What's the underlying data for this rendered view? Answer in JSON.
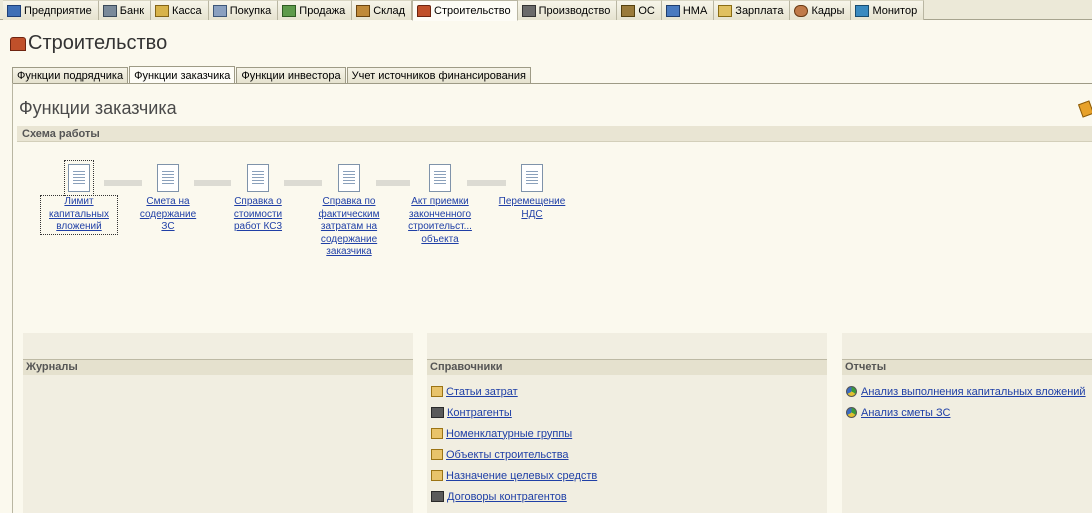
{
  "top_tabs": [
    {
      "label": "Предприятие",
      "icon": "enterprise-icon"
    },
    {
      "label": "Банк",
      "icon": "bank-icon"
    },
    {
      "label": "Касса",
      "icon": "cash-icon"
    },
    {
      "label": "Покупка",
      "icon": "purchase-icon"
    },
    {
      "label": "Продажа",
      "icon": "sale-icon"
    },
    {
      "label": "Склад",
      "icon": "warehouse-icon"
    },
    {
      "label": "Строительство",
      "icon": "construction-icon",
      "active": true
    },
    {
      "label": "Производство",
      "icon": "production-icon"
    },
    {
      "label": "ОС",
      "icon": "fixed-assets-icon"
    },
    {
      "label": "НМА",
      "icon": "intangible-assets-icon"
    },
    {
      "label": "Зарплата",
      "icon": "payroll-icon"
    },
    {
      "label": "Кадры",
      "icon": "staff-icon"
    },
    {
      "label": "Монитор",
      "icon": "monitor-icon"
    }
  ],
  "page": {
    "title": "Строительство"
  },
  "inner_tabs": [
    {
      "label": "Функции подрядчика"
    },
    {
      "label": "Функции заказчика",
      "active": true
    },
    {
      "label": "Функции инвестора"
    },
    {
      "label": "Учет источников финансирования"
    }
  ],
  "section": {
    "title": "Функции заказчика",
    "schema_label": "Схема работы"
  },
  "workflow": [
    {
      "label": "Лимит капитальных вложений"
    },
    {
      "label": "Смета на содержание ЗС"
    },
    {
      "label": "Справка о стоимости работ КС3"
    },
    {
      "label": "Справка по фактическим затратам на содержание заказчика"
    },
    {
      "label": "Акт приемки законченного строительст... объекта"
    },
    {
      "label": "Перемещение НДС"
    }
  ],
  "panels": {
    "journals": {
      "title": "Журналы",
      "items": []
    },
    "directories": {
      "title": "Справочники",
      "items": [
        {
          "label": "Статьи затрат",
          "icon": "book-icon"
        },
        {
          "label": "Контрагенты",
          "icon": "briefcase-icon"
        },
        {
          "label": "Номенклатурные группы",
          "icon": "book-icon"
        },
        {
          "label": "Объекты строительства",
          "icon": "book-icon"
        },
        {
          "label": "Назначение целевых средств",
          "icon": "book-icon"
        },
        {
          "label": "Договоры контрагентов",
          "icon": "briefcase-icon"
        }
      ]
    },
    "reports": {
      "title": "Отчеты",
      "items": [
        {
          "label": "Анализ выполнения капитальных вложений",
          "icon": "pie-chart-icon"
        },
        {
          "label": "Анализ сметы ЗС",
          "icon": "pie-chart-icon"
        }
      ]
    }
  }
}
